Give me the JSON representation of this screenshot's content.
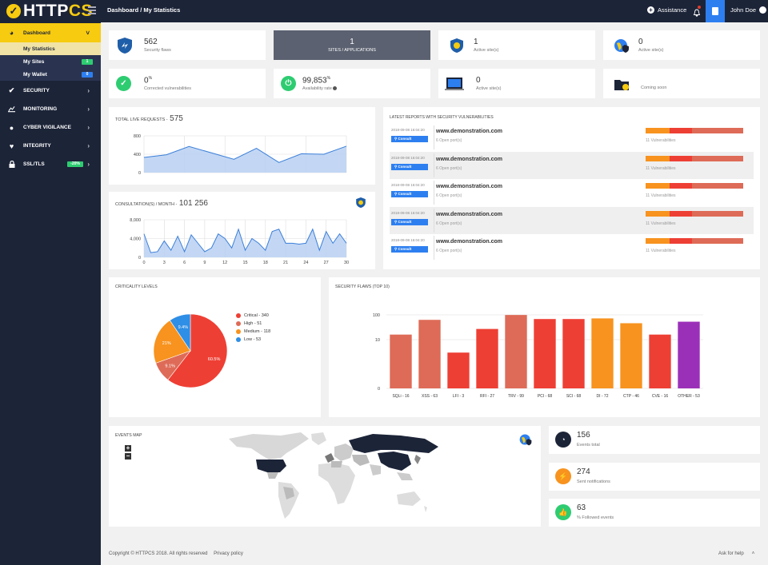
{
  "app": {
    "brand_a": "HTTP",
    "brand_b": "CS",
    "breadcrumb": "Dashboard / My Statistics",
    "assistance": "Assistance",
    "user": "John Doe"
  },
  "sidebar": {
    "dashboard": "Dashboard",
    "subs": [
      {
        "label": "My Statistics"
      },
      {
        "label": "My Sites",
        "badge": "1"
      },
      {
        "label": "My Wallet",
        "badge": "0"
      }
    ],
    "items": [
      {
        "label": "SECURITY"
      },
      {
        "label": "MONITORING"
      },
      {
        "label": "CYBER VIGILANCE"
      },
      {
        "label": "INTEGRITY"
      },
      {
        "label": "SSL/TLS",
        "tag": "-20%"
      }
    ]
  },
  "stats": {
    "flaws": {
      "num": "562",
      "label": "Security flaws"
    },
    "sites": {
      "num": "1",
      "label": "SITES / APPLICATIONS"
    },
    "active1": {
      "num": "1",
      "label": "Active site(s)"
    },
    "active2": {
      "num": "0",
      "label": "Active site(s)"
    },
    "corrected": {
      "num": "0",
      "sup": "%",
      "label": "Corrected vulnerabilities"
    },
    "availability": {
      "num": "99,853",
      "sup": "%",
      "label": "Availability rate"
    },
    "active3": {
      "num": "0",
      "label": "Active site(s)"
    },
    "coming": {
      "label": "Coming soon"
    }
  },
  "live": {
    "title": "TOTAL LIVE REQUESTS - ",
    "value": "575"
  },
  "consult": {
    "title": "CONSULTATION(S) / MONTH - ",
    "value": "101 256"
  },
  "reports": {
    "title": "LATEST REPORTS WITH SECURITY VULNERABILITIES",
    "rows": [
      {
        "date": "2018-09-08 16:04:20",
        "btn": "Consult",
        "site": "www.demonstration.com",
        "ports": "6 Open port(s)",
        "vul": "11 Vulnerabilities"
      },
      {
        "date": "2018-09-08 16:04:20",
        "btn": "Consult",
        "site": "www.demonstration.com",
        "ports": "6 Open port(s)",
        "vul": "11 Vulnerabilities"
      },
      {
        "date": "2018-09-08 16:04:20",
        "btn": "Consult",
        "site": "www.demonstration.com",
        "ports": "6 Open port(s)",
        "vul": "11 Vulnerabilities"
      },
      {
        "date": "2018-09-08 16:04:20",
        "btn": "Consult",
        "site": "www.demonstration.com",
        "ports": "6 Open port(s)",
        "vul": "11 Vulnerabilities"
      },
      {
        "date": "2018-09-08 16:04:20",
        "btn": "Consult",
        "site": "www.demonstration.com",
        "ports": "6 Open port(s)",
        "vul": "11 Vulnerabilities"
      }
    ]
  },
  "criticality": {
    "title": "CRITICALITY LEVELS"
  },
  "flaws_top": {
    "title": "SECURITY FLAWS (TOP 10)"
  },
  "events_map": {
    "title": "EVENTS MAP",
    "zoom_in": "+",
    "zoom_out": "−"
  },
  "events": [
    {
      "num": "156",
      "label": "Events total",
      "color": "#1c2438"
    },
    {
      "num": "274",
      "label": "Sent notifications",
      "color": "#f7931e"
    },
    {
      "num": "63",
      "label": "% Followed events",
      "color": "#2ecc71"
    }
  ],
  "footer": {
    "copyright": "Copyright © HTTPCS 2018. All rights reserved",
    "privacy": "Privacy policy",
    "help": "Ask for help"
  },
  "colors": {
    "accent": "#f7cb0f",
    "navy": "#1c2438",
    "blue": "#2d7ff0"
  },
  "chart_data": [
    {
      "type": "area",
      "name": "live",
      "x": [
        0,
        1,
        2,
        3,
        4,
        5,
        6,
        7,
        8,
        9
      ],
      "values": [
        330,
        390,
        570,
        430,
        290,
        530,
        220,
        410,
        400,
        575
      ],
      "yticks": [
        "800",
        "400",
        "0"
      ],
      "ylim": [
        0,
        800
      ]
    },
    {
      "type": "area",
      "name": "consultations",
      "x": [
        0,
        1,
        2,
        3,
        4,
        5,
        6,
        7,
        8,
        9,
        10,
        11,
        12,
        13,
        14,
        15,
        16,
        17,
        18,
        19,
        20,
        21,
        22,
        23,
        24,
        25,
        26,
        27,
        28,
        29,
        30
      ],
      "values": [
        5000,
        1000,
        1200,
        3500,
        1500,
        4500,
        1200,
        4800,
        3000,
        1200,
        2000,
        5000,
        4000,
        2000,
        6000,
        1500,
        4000,
        3000,
        1500,
        5500,
        6000,
        3000,
        3000,
        2800,
        3000,
        6000,
        1500,
        5500,
        3000,
        5000,
        3000
      ],
      "yticks": [
        "8,000",
        "4,000",
        "0"
      ],
      "xticks": [
        "0",
        "3",
        "6",
        "9",
        "12",
        "15",
        "18",
        "21",
        "24",
        "27",
        "30"
      ],
      "ylim": [
        0,
        8000
      ]
    },
    {
      "type": "pie",
      "labels": [
        "Critical - 340",
        "High - 51",
        "Medium - 118",
        "Low - 53"
      ],
      "values": [
        340,
        51,
        118,
        53
      ],
      "percent_labels": [
        "60.5%",
        "9.1%",
        "21%",
        "9.4%"
      ],
      "colors": [
        "#ee3f34",
        "#de6b57",
        "#f7931e",
        "#2f8ee5"
      ]
    },
    {
      "type": "bar",
      "scale": "log",
      "categories": [
        "SQLi - 16",
        "XSS - 63",
        "LFI - 3",
        "RFI - 27",
        "TRV - 99",
        "PCI - 68",
        "SCI - 68",
        "DI - 72",
        "CTP - 46",
        "CVE - 16",
        "OTHER - 53"
      ],
      "values": [
        16,
        63,
        3,
        27,
        99,
        68,
        68,
        72,
        46,
        16,
        53
      ],
      "colors": [
        "#de6b57",
        "#de6b57",
        "#ee3f34",
        "#ee3f34",
        "#de6b57",
        "#ee3f34",
        "#ee3f34",
        "#f7931e",
        "#f7931e",
        "#ee3f34",
        "#9b30b8"
      ],
      "yticks": [
        "100",
        "10",
        "0"
      ]
    }
  ]
}
